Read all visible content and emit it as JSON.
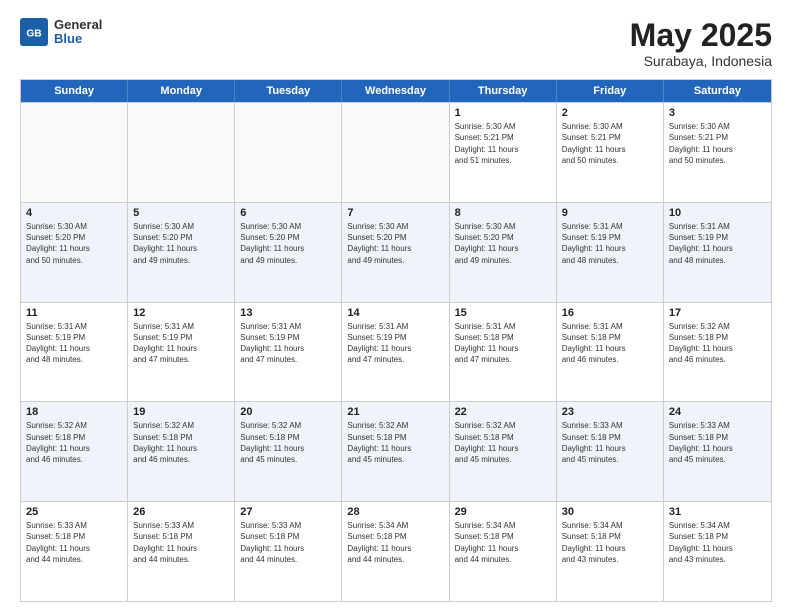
{
  "logo": {
    "general": "General",
    "blue": "Blue"
  },
  "title": "May 2025",
  "subtitle": "Surabaya, Indonesia",
  "days": [
    "Sunday",
    "Monday",
    "Tuesday",
    "Wednesday",
    "Thursday",
    "Friday",
    "Saturday"
  ],
  "rows": [
    [
      {
        "day": "",
        "content": ""
      },
      {
        "day": "",
        "content": ""
      },
      {
        "day": "",
        "content": ""
      },
      {
        "day": "",
        "content": ""
      },
      {
        "day": "1",
        "content": "Sunrise: 5:30 AM\nSunset: 5:21 PM\nDaylight: 11 hours\nand 51 minutes."
      },
      {
        "day": "2",
        "content": "Sunrise: 5:30 AM\nSunset: 5:21 PM\nDaylight: 11 hours\nand 50 minutes."
      },
      {
        "day": "3",
        "content": "Sunrise: 5:30 AM\nSunset: 5:21 PM\nDaylight: 11 hours\nand 50 minutes."
      }
    ],
    [
      {
        "day": "4",
        "content": "Sunrise: 5:30 AM\nSunset: 5:20 PM\nDaylight: 11 hours\nand 50 minutes."
      },
      {
        "day": "5",
        "content": "Sunrise: 5:30 AM\nSunset: 5:20 PM\nDaylight: 11 hours\nand 49 minutes."
      },
      {
        "day": "6",
        "content": "Sunrise: 5:30 AM\nSunset: 5:20 PM\nDaylight: 11 hours\nand 49 minutes."
      },
      {
        "day": "7",
        "content": "Sunrise: 5:30 AM\nSunset: 5:20 PM\nDaylight: 11 hours\nand 49 minutes."
      },
      {
        "day": "8",
        "content": "Sunrise: 5:30 AM\nSunset: 5:20 PM\nDaylight: 11 hours\nand 49 minutes."
      },
      {
        "day": "9",
        "content": "Sunrise: 5:31 AM\nSunset: 5:19 PM\nDaylight: 11 hours\nand 48 minutes."
      },
      {
        "day": "10",
        "content": "Sunrise: 5:31 AM\nSunset: 5:19 PM\nDaylight: 11 hours\nand 48 minutes."
      }
    ],
    [
      {
        "day": "11",
        "content": "Sunrise: 5:31 AM\nSunset: 5:19 PM\nDaylight: 11 hours\nand 48 minutes."
      },
      {
        "day": "12",
        "content": "Sunrise: 5:31 AM\nSunset: 5:19 PM\nDaylight: 11 hours\nand 47 minutes."
      },
      {
        "day": "13",
        "content": "Sunrise: 5:31 AM\nSunset: 5:19 PM\nDaylight: 11 hours\nand 47 minutes."
      },
      {
        "day": "14",
        "content": "Sunrise: 5:31 AM\nSunset: 5:19 PM\nDaylight: 11 hours\nand 47 minutes."
      },
      {
        "day": "15",
        "content": "Sunrise: 5:31 AM\nSunset: 5:18 PM\nDaylight: 11 hours\nand 47 minutes."
      },
      {
        "day": "16",
        "content": "Sunrise: 5:31 AM\nSunset: 5:18 PM\nDaylight: 11 hours\nand 46 minutes."
      },
      {
        "day": "17",
        "content": "Sunrise: 5:32 AM\nSunset: 5:18 PM\nDaylight: 11 hours\nand 46 minutes."
      }
    ],
    [
      {
        "day": "18",
        "content": "Sunrise: 5:32 AM\nSunset: 5:18 PM\nDaylight: 11 hours\nand 46 minutes."
      },
      {
        "day": "19",
        "content": "Sunrise: 5:32 AM\nSunset: 5:18 PM\nDaylight: 11 hours\nand 46 minutes."
      },
      {
        "day": "20",
        "content": "Sunrise: 5:32 AM\nSunset: 5:18 PM\nDaylight: 11 hours\nand 45 minutes."
      },
      {
        "day": "21",
        "content": "Sunrise: 5:32 AM\nSunset: 5:18 PM\nDaylight: 11 hours\nand 45 minutes."
      },
      {
        "day": "22",
        "content": "Sunrise: 5:32 AM\nSunset: 5:18 PM\nDaylight: 11 hours\nand 45 minutes."
      },
      {
        "day": "23",
        "content": "Sunrise: 5:33 AM\nSunset: 5:18 PM\nDaylight: 11 hours\nand 45 minutes."
      },
      {
        "day": "24",
        "content": "Sunrise: 5:33 AM\nSunset: 5:18 PM\nDaylight: 11 hours\nand 45 minutes."
      }
    ],
    [
      {
        "day": "25",
        "content": "Sunrise: 5:33 AM\nSunset: 5:18 PM\nDaylight: 11 hours\nand 44 minutes."
      },
      {
        "day": "26",
        "content": "Sunrise: 5:33 AM\nSunset: 5:18 PM\nDaylight: 11 hours\nand 44 minutes."
      },
      {
        "day": "27",
        "content": "Sunrise: 5:33 AM\nSunset: 5:18 PM\nDaylight: 11 hours\nand 44 minutes."
      },
      {
        "day": "28",
        "content": "Sunrise: 5:34 AM\nSunset: 5:18 PM\nDaylight: 11 hours\nand 44 minutes."
      },
      {
        "day": "29",
        "content": "Sunrise: 5:34 AM\nSunset: 5:18 PM\nDaylight: 11 hours\nand 44 minutes."
      },
      {
        "day": "30",
        "content": "Sunrise: 5:34 AM\nSunset: 5:18 PM\nDaylight: 11 hours\nand 43 minutes."
      },
      {
        "day": "31",
        "content": "Sunrise: 5:34 AM\nSunset: 5:18 PM\nDaylight: 11 hours\nand 43 minutes."
      }
    ]
  ]
}
